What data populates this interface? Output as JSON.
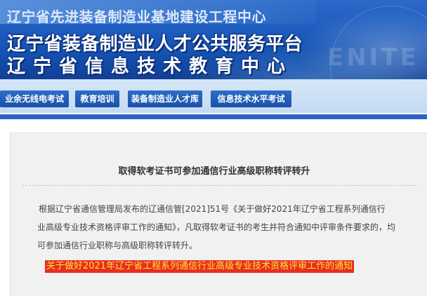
{
  "header": {
    "top_title": "辽宁省先进装备制造业基地建设工程中心",
    "line1": "辽宁省装备制造业人才公共服务平台",
    "line2": "辽宁省信息技术教育中心",
    "watermark": "ENITE"
  },
  "nav": {
    "items": [
      {
        "label": "业余无线电考试"
      },
      {
        "label": "教育培训"
      },
      {
        "label": "装备制造业人才库"
      },
      {
        "label": "信息技术水平考试"
      }
    ]
  },
  "article": {
    "title": "取得软考证书可参加通信行业高级职称转评转升",
    "lines": [
      "根据辽宁省通信管理局发布的辽通信管[2021]51号《关于做好2021年辽宁省工程系列通信行",
      "业高级专业技术资格评审工作的通知》，凡取得软考证书的考生并符合通知中评审条件要求的，均",
      "可参加通信行业职称与高级职称转评转升。"
    ],
    "highlight_link": "关于做好2021年辽宁省工程系列通信行业高级专业技术资格评审工作的通知"
  },
  "colors": {
    "banner": "#1e5cbf",
    "nav_button": "#1a52a8",
    "highlight_bg": "#e82e1f",
    "highlight_text": "#ffe23a"
  }
}
